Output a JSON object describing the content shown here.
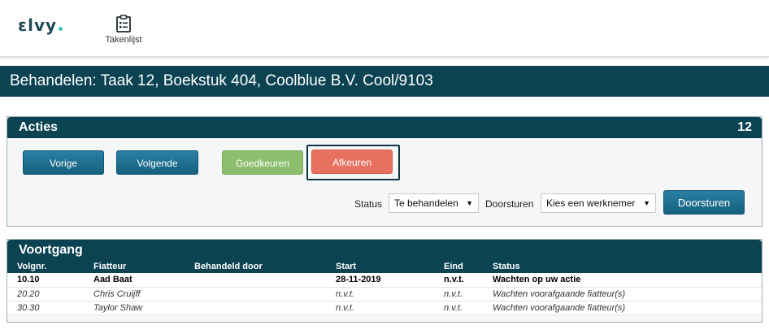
{
  "app": {
    "logo_text": "ɛlvy",
    "nav": [
      {
        "label": "Takenlijst",
        "icon": "clipboard-list-icon"
      }
    ]
  },
  "page": {
    "title": "Behandelen: Taak 12, Boekstuk 404, Coolblue B.V. Cool/9103"
  },
  "acties": {
    "title": "Acties",
    "count": "12",
    "buttons": {
      "previous": "Vorige",
      "next": "Volgende",
      "approve": "Goedkeuren",
      "reject": "Afkeuren",
      "forward": "Doorsturen"
    },
    "status_label": "Status",
    "status_value": "Te behandelen",
    "forward_label": "Doorsturen",
    "forward_placeholder": "Kies een werknemer",
    "colors": {
      "blue": "#1a6a8c",
      "green": "#8cbf6d",
      "red": "#e8705f",
      "header": "#0b4352"
    }
  },
  "voortgang": {
    "title": "Voortgang",
    "columns": [
      "Volgnr.",
      "Fiatteur",
      "Behandeld door",
      "Start",
      "Eind",
      "Status"
    ],
    "rows": [
      {
        "volgnr": "10.10",
        "fiatteur": "Aad Baat",
        "behandeld": "",
        "start": "28-11-2019",
        "eind": "n.v.t.",
        "status": "Wachten op uw actie"
      },
      {
        "volgnr": "20.20",
        "fiatteur": "Chris Cruijff",
        "behandeld": "",
        "start": "n.v.t.",
        "eind": "n.v.t.",
        "status": "Wachten voorafgaande fiatteur(s)"
      },
      {
        "volgnr": "30.30",
        "fiatteur": "Taylor Shaw",
        "behandeld": "",
        "start": "n.v.t.",
        "eind": "n.v.t.",
        "status": "Wachten voorafgaande fiatteur(s)"
      }
    ]
  }
}
